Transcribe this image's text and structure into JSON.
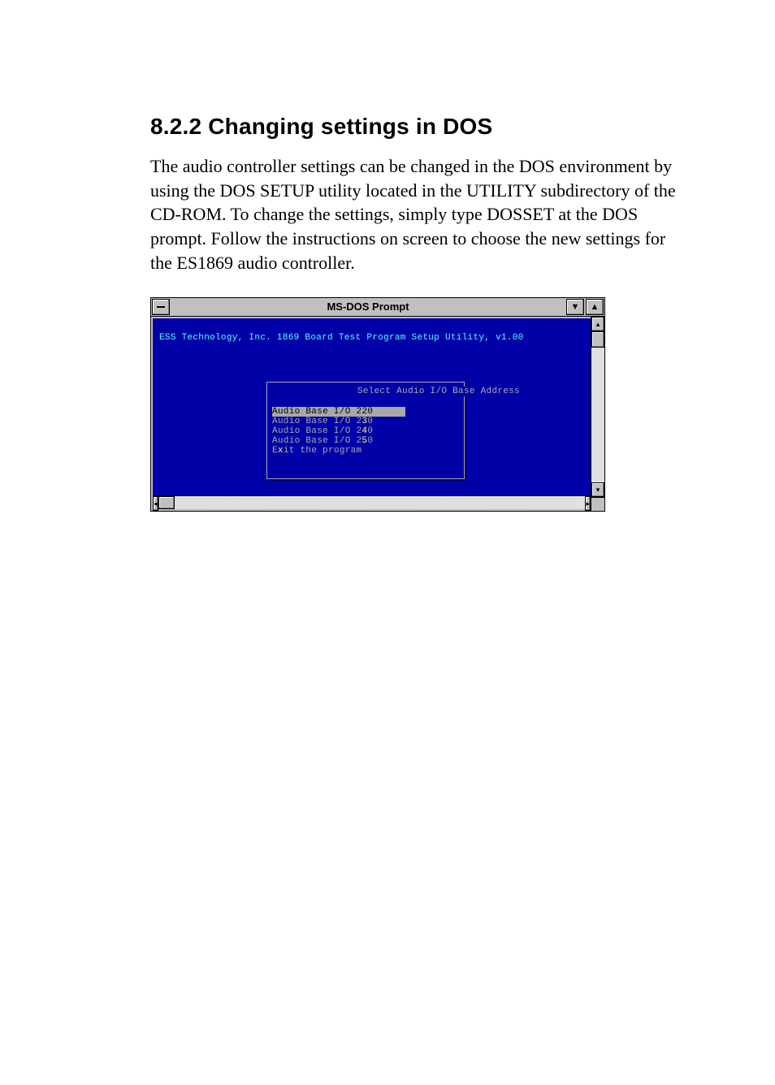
{
  "heading": "8.2.2 Changing settings in DOS",
  "paragraph": "The audio controller settings can be changed in the DOS environment by using the DOS SETUP utility located in the UTILITY subdirectory of the CD-ROM. To change the settings, simply type DOSSET at the DOS prompt. Follow the instructions on screen to choose the new settings for the ES1869 audio controller.",
  "doswin": {
    "title": "MS-DOS Prompt",
    "header_line": "ESS Technology, Inc. 1869 Board Test Program Setup Utility, v1.00",
    "menu_title": "Select Audio I/O Base Address",
    "items": [
      {
        "prefix": "Audio Base I/O ",
        "hk": "2",
        "suffix": "20",
        "selected": true
      },
      {
        "prefix": "Audio Base I/O 2",
        "hk": "3",
        "suffix": "0",
        "selected": false
      },
      {
        "prefix": "Audio Base I/O 2",
        "hk": "4",
        "suffix": "0",
        "selected": false
      },
      {
        "prefix": "Audio Base I/O 2",
        "hk": "5",
        "suffix": "0",
        "selected": false
      },
      {
        "prefix": "E",
        "hk": "x",
        "suffix": "it the program",
        "selected": false
      }
    ]
  }
}
